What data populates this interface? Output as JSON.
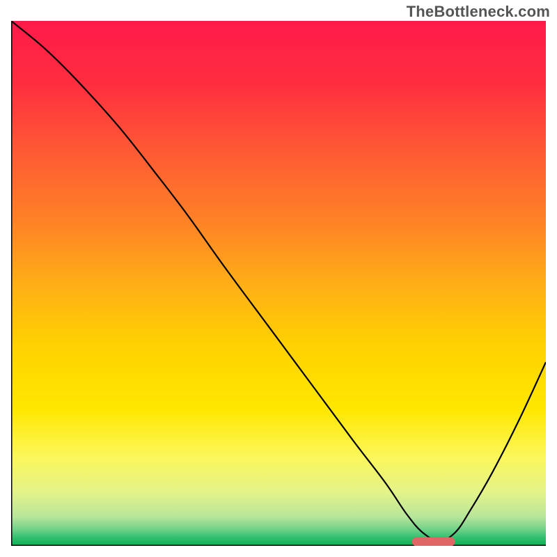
{
  "watermark_text": "TheBottleneck.com",
  "chart_data": {
    "type": "line",
    "title": "",
    "xlabel": "",
    "ylabel": "",
    "xlim": [
      0,
      100
    ],
    "ylim": [
      0,
      100
    ],
    "grid": false,
    "legend": false,
    "notes": "Vertical gradient background from red (top) through orange/yellow to green (bottom). Single black curve descending to a valley ~x≈80 then rising. Short red rounded marker on the x-axis ~x≈76–82.",
    "gradient_stops": [
      {
        "offset": 0.0,
        "color": "#ff1a49"
      },
      {
        "offset": 0.12,
        "color": "#ff2e3f"
      },
      {
        "offset": 0.25,
        "color": "#ff5a34"
      },
      {
        "offset": 0.38,
        "color": "#ff8126"
      },
      {
        "offset": 0.5,
        "color": "#ffae17"
      },
      {
        "offset": 0.62,
        "color": "#ffd200"
      },
      {
        "offset": 0.74,
        "color": "#ffe700"
      },
      {
        "offset": 0.83,
        "color": "#fcf75b"
      },
      {
        "offset": 0.9,
        "color": "#e2f38a"
      },
      {
        "offset": 0.945,
        "color": "#b7e59a"
      },
      {
        "offset": 0.97,
        "color": "#6bd087"
      },
      {
        "offset": 0.985,
        "color": "#2fbf6e"
      },
      {
        "offset": 1.0,
        "color": "#0ab153"
      }
    ],
    "series": [
      {
        "name": "curve",
        "x": [
          0,
          6,
          12,
          20,
          27,
          33,
          40,
          48,
          56,
          64,
          70,
          74,
          77,
          80,
          83,
          86,
          90,
          95,
          100
        ],
        "y": [
          100,
          95,
          89,
          80,
          71,
          63,
          53,
          42,
          31,
          20,
          12,
          6,
          2.5,
          1,
          2.5,
          7,
          14,
          24,
          35
        ]
      }
    ],
    "marker": {
      "x0": 75,
      "x1": 83,
      "y": 0.8,
      "thickness": 1.7,
      "color": "#e06666"
    },
    "axis": {
      "stroke": "#000000",
      "width": 3
    }
  }
}
